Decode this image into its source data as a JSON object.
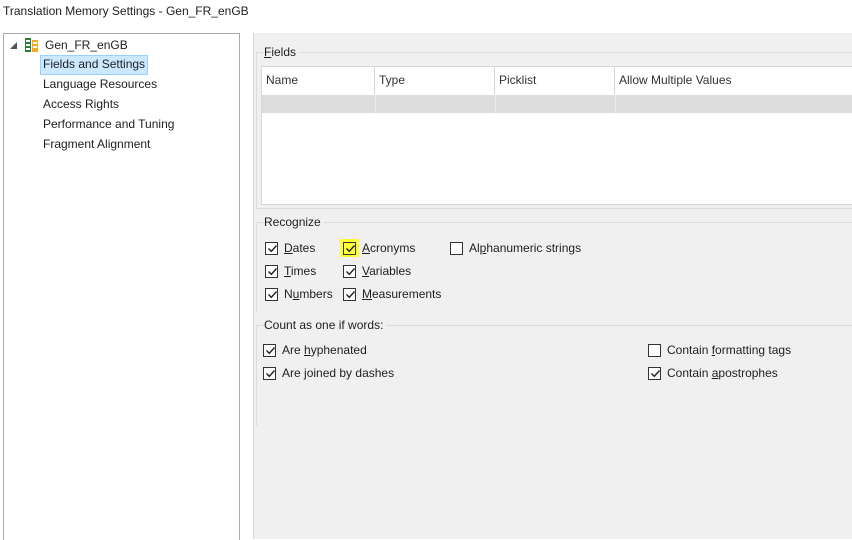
{
  "window": {
    "title": "Translation Memory Settings - Gen_FR_enGB"
  },
  "tree": {
    "root_label": "Gen_FR_enGB",
    "items": [
      {
        "label": "Fields and Settings",
        "selected": true
      },
      {
        "label": "Language Resources",
        "selected": false
      },
      {
        "label": "Access Rights",
        "selected": false
      },
      {
        "label": "Performance and Tuning",
        "selected": false
      },
      {
        "label": "Fragment Alignment",
        "selected": false
      }
    ]
  },
  "fields": {
    "title_prefix": "F",
    "title_rest": "ields",
    "columns": [
      "Name",
      "Type",
      "Picklist",
      "Allow Multiple Values"
    ]
  },
  "recognize": {
    "title": "Recognize",
    "options": [
      {
        "pre": "",
        "u": "D",
        "post": "ates",
        "checked": true
      },
      {
        "pre": "",
        "u": "T",
        "post": "imes",
        "checked": true
      },
      {
        "pre": "N",
        "u": "u",
        "post": "mbers",
        "checked": true
      },
      {
        "pre": "",
        "u": "A",
        "post": "cronyms",
        "checked": true,
        "highlighted": true
      },
      {
        "pre": "",
        "u": "V",
        "post": "ariables",
        "checked": true
      },
      {
        "pre": "",
        "u": "M",
        "post": "easurements",
        "checked": true
      },
      {
        "pre": "Al",
        "u": "p",
        "post": "hanumeric strings",
        "checked": false
      }
    ]
  },
  "count_as_one": {
    "title": "Count as one if words:",
    "options": [
      {
        "pre": "Are ",
        "u": "h",
        "post": "yphenated",
        "checked": true
      },
      {
        "pre": "Are ",
        "u": "j",
        "post": "oined by dashes",
        "checked": true
      },
      {
        "pre": "Contain ",
        "u": "f",
        "post": "ormatting tags",
        "checked": false
      },
      {
        "pre": "Contain ",
        "u": "a",
        "post": "postrophes",
        "checked": true
      }
    ]
  }
}
